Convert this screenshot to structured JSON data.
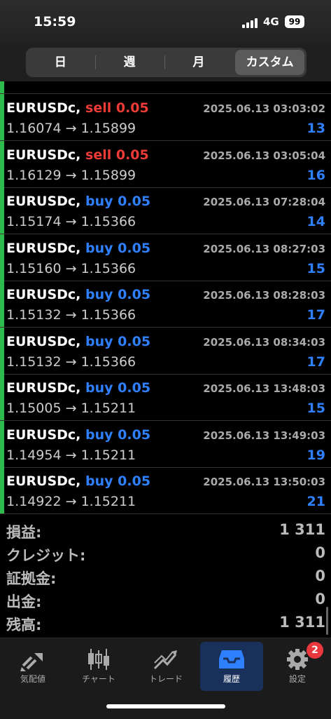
{
  "status_bar": {
    "time": "15:59",
    "network": "4G",
    "battery": "99"
  },
  "period_tabs": [
    {
      "label": "日"
    },
    {
      "label": "週"
    },
    {
      "label": "月"
    },
    {
      "label": "カスタム",
      "active": true
    }
  ],
  "trades": [
    {
      "symbol": "EURUSDc,",
      "side": "sell 0.05",
      "datetime": "2025.06.13 03:03:02",
      "prices": "1.16074 → 1.15899",
      "points": "13",
      "type": "sell"
    },
    {
      "symbol": "EURUSDc,",
      "side": "sell 0.05",
      "datetime": "2025.06.13 03:05:04",
      "prices": "1.16129 → 1.15899",
      "points": "16",
      "type": "sell"
    },
    {
      "symbol": "EURUSDc,",
      "side": "buy 0.05",
      "datetime": "2025.06.13 07:28:04",
      "prices": "1.15174 → 1.15366",
      "points": "14",
      "type": "buy"
    },
    {
      "symbol": "EURUSDc,",
      "side": "buy 0.05",
      "datetime": "2025.06.13 08:27:03",
      "prices": "1.15160 → 1.15366",
      "points": "15",
      "type": "buy"
    },
    {
      "symbol": "EURUSDc,",
      "side": "buy 0.05",
      "datetime": "2025.06.13 08:28:03",
      "prices": "1.15132 → 1.15366",
      "points": "17",
      "type": "buy"
    },
    {
      "symbol": "EURUSDc,",
      "side": "buy 0.05",
      "datetime": "2025.06.13 08:34:03",
      "prices": "1.15132 → 1.15366",
      "points": "17",
      "type": "buy"
    },
    {
      "symbol": "EURUSDc,",
      "side": "buy 0.05",
      "datetime": "2025.06.13 13:48:03",
      "prices": "1.15005 → 1.15211",
      "points": "15",
      "type": "buy"
    },
    {
      "symbol": "EURUSDc,",
      "side": "buy 0.05",
      "datetime": "2025.06.13 13:49:03",
      "prices": "1.14954 → 1.15211",
      "points": "19",
      "type": "buy"
    },
    {
      "symbol": "EURUSDc,",
      "side": "buy 0.05",
      "datetime": "2025.06.13 13:50:03",
      "prices": "1.14922 → 1.15211",
      "points": "21",
      "type": "buy"
    }
  ],
  "summary": [
    {
      "label": "損益:",
      "value": "1 311"
    },
    {
      "label": "クレジット:",
      "value": "0"
    },
    {
      "label": "証拠金:",
      "value": "0"
    },
    {
      "label": "出金:",
      "value": "0"
    },
    {
      "label": "残高:",
      "value": "1 311"
    }
  ],
  "tabbar": [
    {
      "label": "気配値",
      "icon": "quotes-icon"
    },
    {
      "label": "チャート",
      "icon": "chart-icon"
    },
    {
      "label": "トレード",
      "icon": "trade-icon"
    },
    {
      "label": "履歴",
      "icon": "history-icon",
      "active": true
    },
    {
      "label": "設定",
      "icon": "gear-icon",
      "badge": "2"
    }
  ],
  "colors": {
    "sell": "#ee3b36",
    "buy": "#2f80ff",
    "profit_bar": "#2dbb4d",
    "active_tab": "#18305a"
  }
}
